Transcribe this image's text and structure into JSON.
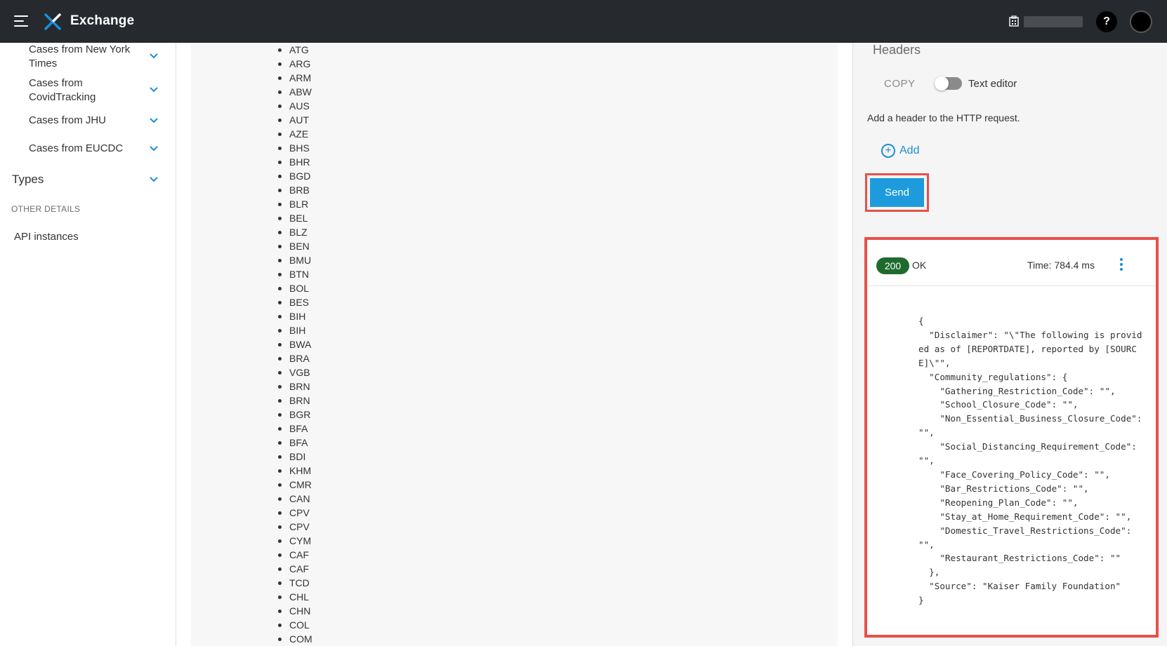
{
  "app": {
    "title": "Exchange"
  },
  "sidebar": {
    "items": [
      {
        "label": "Cases from New York Times"
      },
      {
        "label": "Cases from CovidTracking"
      },
      {
        "label": "Cases from JHU"
      },
      {
        "label": "Cases from EUCDC"
      }
    ],
    "types_label": "Types",
    "other_details_label": "OTHER DETAILS",
    "api_instances_label": "API instances"
  },
  "country_list": [
    "ATG",
    "ARG",
    "ARM",
    "ABW",
    "AUS",
    "AUT",
    "AZE",
    "BHS",
    "BHR",
    "BGD",
    "BRB",
    "BLR",
    "BEL",
    "BLZ",
    "BEN",
    "BMU",
    "BTN",
    "BOL",
    "BES",
    "BIH",
    "BIH",
    "BWA",
    "BRA",
    "VGB",
    "BRN",
    "BRN",
    "BGR",
    "BFA",
    "BFA",
    "BDI",
    "KHM",
    "CMR",
    "CAN",
    "CPV",
    "CPV",
    "CYM",
    "CAF",
    "CAF",
    "TCD",
    "CHL",
    "CHN",
    "COL",
    "COM"
  ],
  "request": {
    "headers_title": "Headers",
    "copy_label": "COPY",
    "text_editor_label": "Text editor",
    "hint": "Add a header to the HTTP request.",
    "add_label": "Add",
    "send_label": "Send"
  },
  "response": {
    "status_code": "200",
    "status_text": "OK",
    "time": "Time: 784.4 ms",
    "body": "{\n  \"Disclaimer\": \"\\\"The following is provided as of [REPORTDATE], reported by [SOURCE]\\\"\",\n  \"Community_regulations\": {\n    \"Gathering_Restriction_Code\": \"\",\n    \"School_Closure_Code\": \"\",\n    \"Non_Essential_Business_Closure_Code\": \"\",\n    \"Social_Distancing_Requirement_Code\": \"\",\n    \"Face_Covering_Policy_Code\": \"\",\n    \"Bar_Restrictions_Code\": \"\",\n    \"Reopening_Plan_Code\": \"\",\n    \"Stay_at_Home_Requirement_Code\": \"\",\n    \"Domestic_Travel_Restrictions_Code\": \"\",\n    \"Restaurant_Restrictions_Code\": \"\"\n  },\n  \"Source\": \"Kaiser Family Foundation\"\n}"
  },
  "colors": {
    "topbar": "#262a2e",
    "accent": "#1a8fd6",
    "send_button": "#1d9bdd",
    "highlight_border": "#e8504a",
    "status_ok": "#1e6b2e"
  },
  "icons": {
    "menu": "hamburger-menu-icon",
    "logo": "exchange-logo-icon",
    "org": "building-icon",
    "help": "help-icon",
    "avatar": "user-avatar-icon",
    "chevron": "chevron-down-icon",
    "add": "plus-circle-icon",
    "more": "kebab-menu-icon"
  }
}
